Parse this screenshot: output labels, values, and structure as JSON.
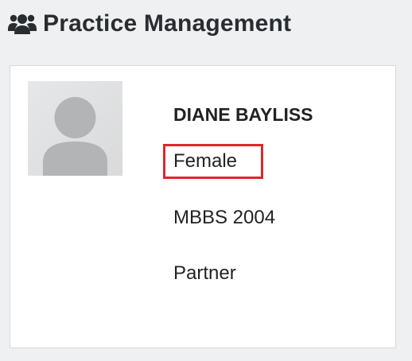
{
  "header": {
    "icon": "users-icon",
    "title": "Practice Management"
  },
  "profile": {
    "avatar_icon": "user-placeholder-avatar",
    "name": "DIANE BAYLISS",
    "gender": "Female",
    "qualification": "MBBS 2004",
    "role": "Partner"
  },
  "colors": {
    "page_background": "#eef0f2",
    "highlight_border": "#e0262c",
    "title_text": "#2a2d30"
  }
}
